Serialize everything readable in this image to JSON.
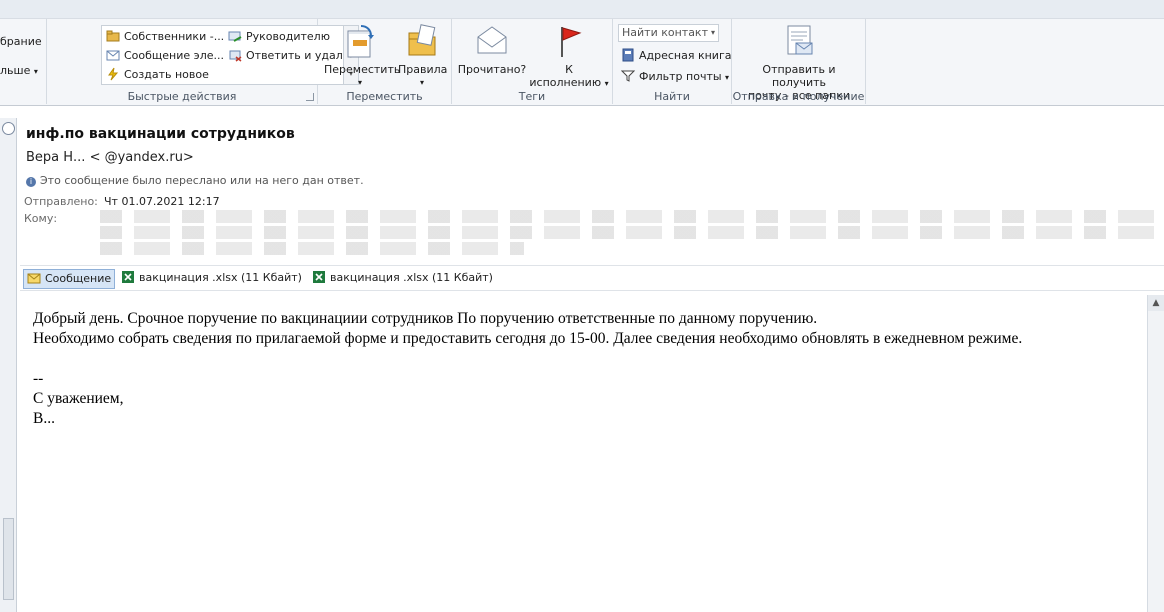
{
  "ribbon": {
    "left_cut": {
      "item1": "брание",
      "item2": "льше"
    },
    "quick_steps": {
      "items": [
        "Собственники -...",
        "Руководителю",
        "Сообщение эле...",
        "Ответить и удал...",
        "Создать новое"
      ],
      "label": "Быстрые действия"
    },
    "move": {
      "move_label": "Переместить",
      "rules_label": "Правила",
      "label": "Переместить"
    },
    "tags": {
      "read_label": "Прочитано?",
      "followup_line1": "К",
      "followup_line2": "исполнению",
      "label": "Теги"
    },
    "find": {
      "find_contact": "Найти контакт",
      "address_book": "Адресная книга",
      "filter_mail": "Фильтр почты",
      "label": "Найти"
    },
    "sendrecv": {
      "line1": "Отправить и получить",
      "line2": "почту - все папки",
      "label": "Отправка и получение"
    }
  },
  "message": {
    "subject": "инф.по вакцинации сотрудников",
    "from": "Вера Н...         <                    @yandex.ru>",
    "forwarded_notice": "Это сообщение было переслано или на него дан ответ.",
    "sent_label": "Отправлено:",
    "sent_value": "Чт 01.07.2021 12:17",
    "to_label": "Кому:",
    "attachments": {
      "message_tab": "Сообщение",
      "file1": "вакцинация       .xlsx (11 Кбайт)",
      "file2": "вакцинация    .xlsx (11 Кбайт)"
    },
    "body": "Добрый день. Срочное поручение по вакцинациии сотрудников                По поручению                                ответственные по данному поручению.\nНеобходимо собрать сведения по прилагаемой форме и предоставить сегодня до 15-00. Далее сведения необходимо обновлять в ежедневном режиме.\n\n--\nС уважением,\nВ...",
    "colors": {
      "accent": "#2b579a",
      "active_tab": "#d6e5f6"
    }
  }
}
